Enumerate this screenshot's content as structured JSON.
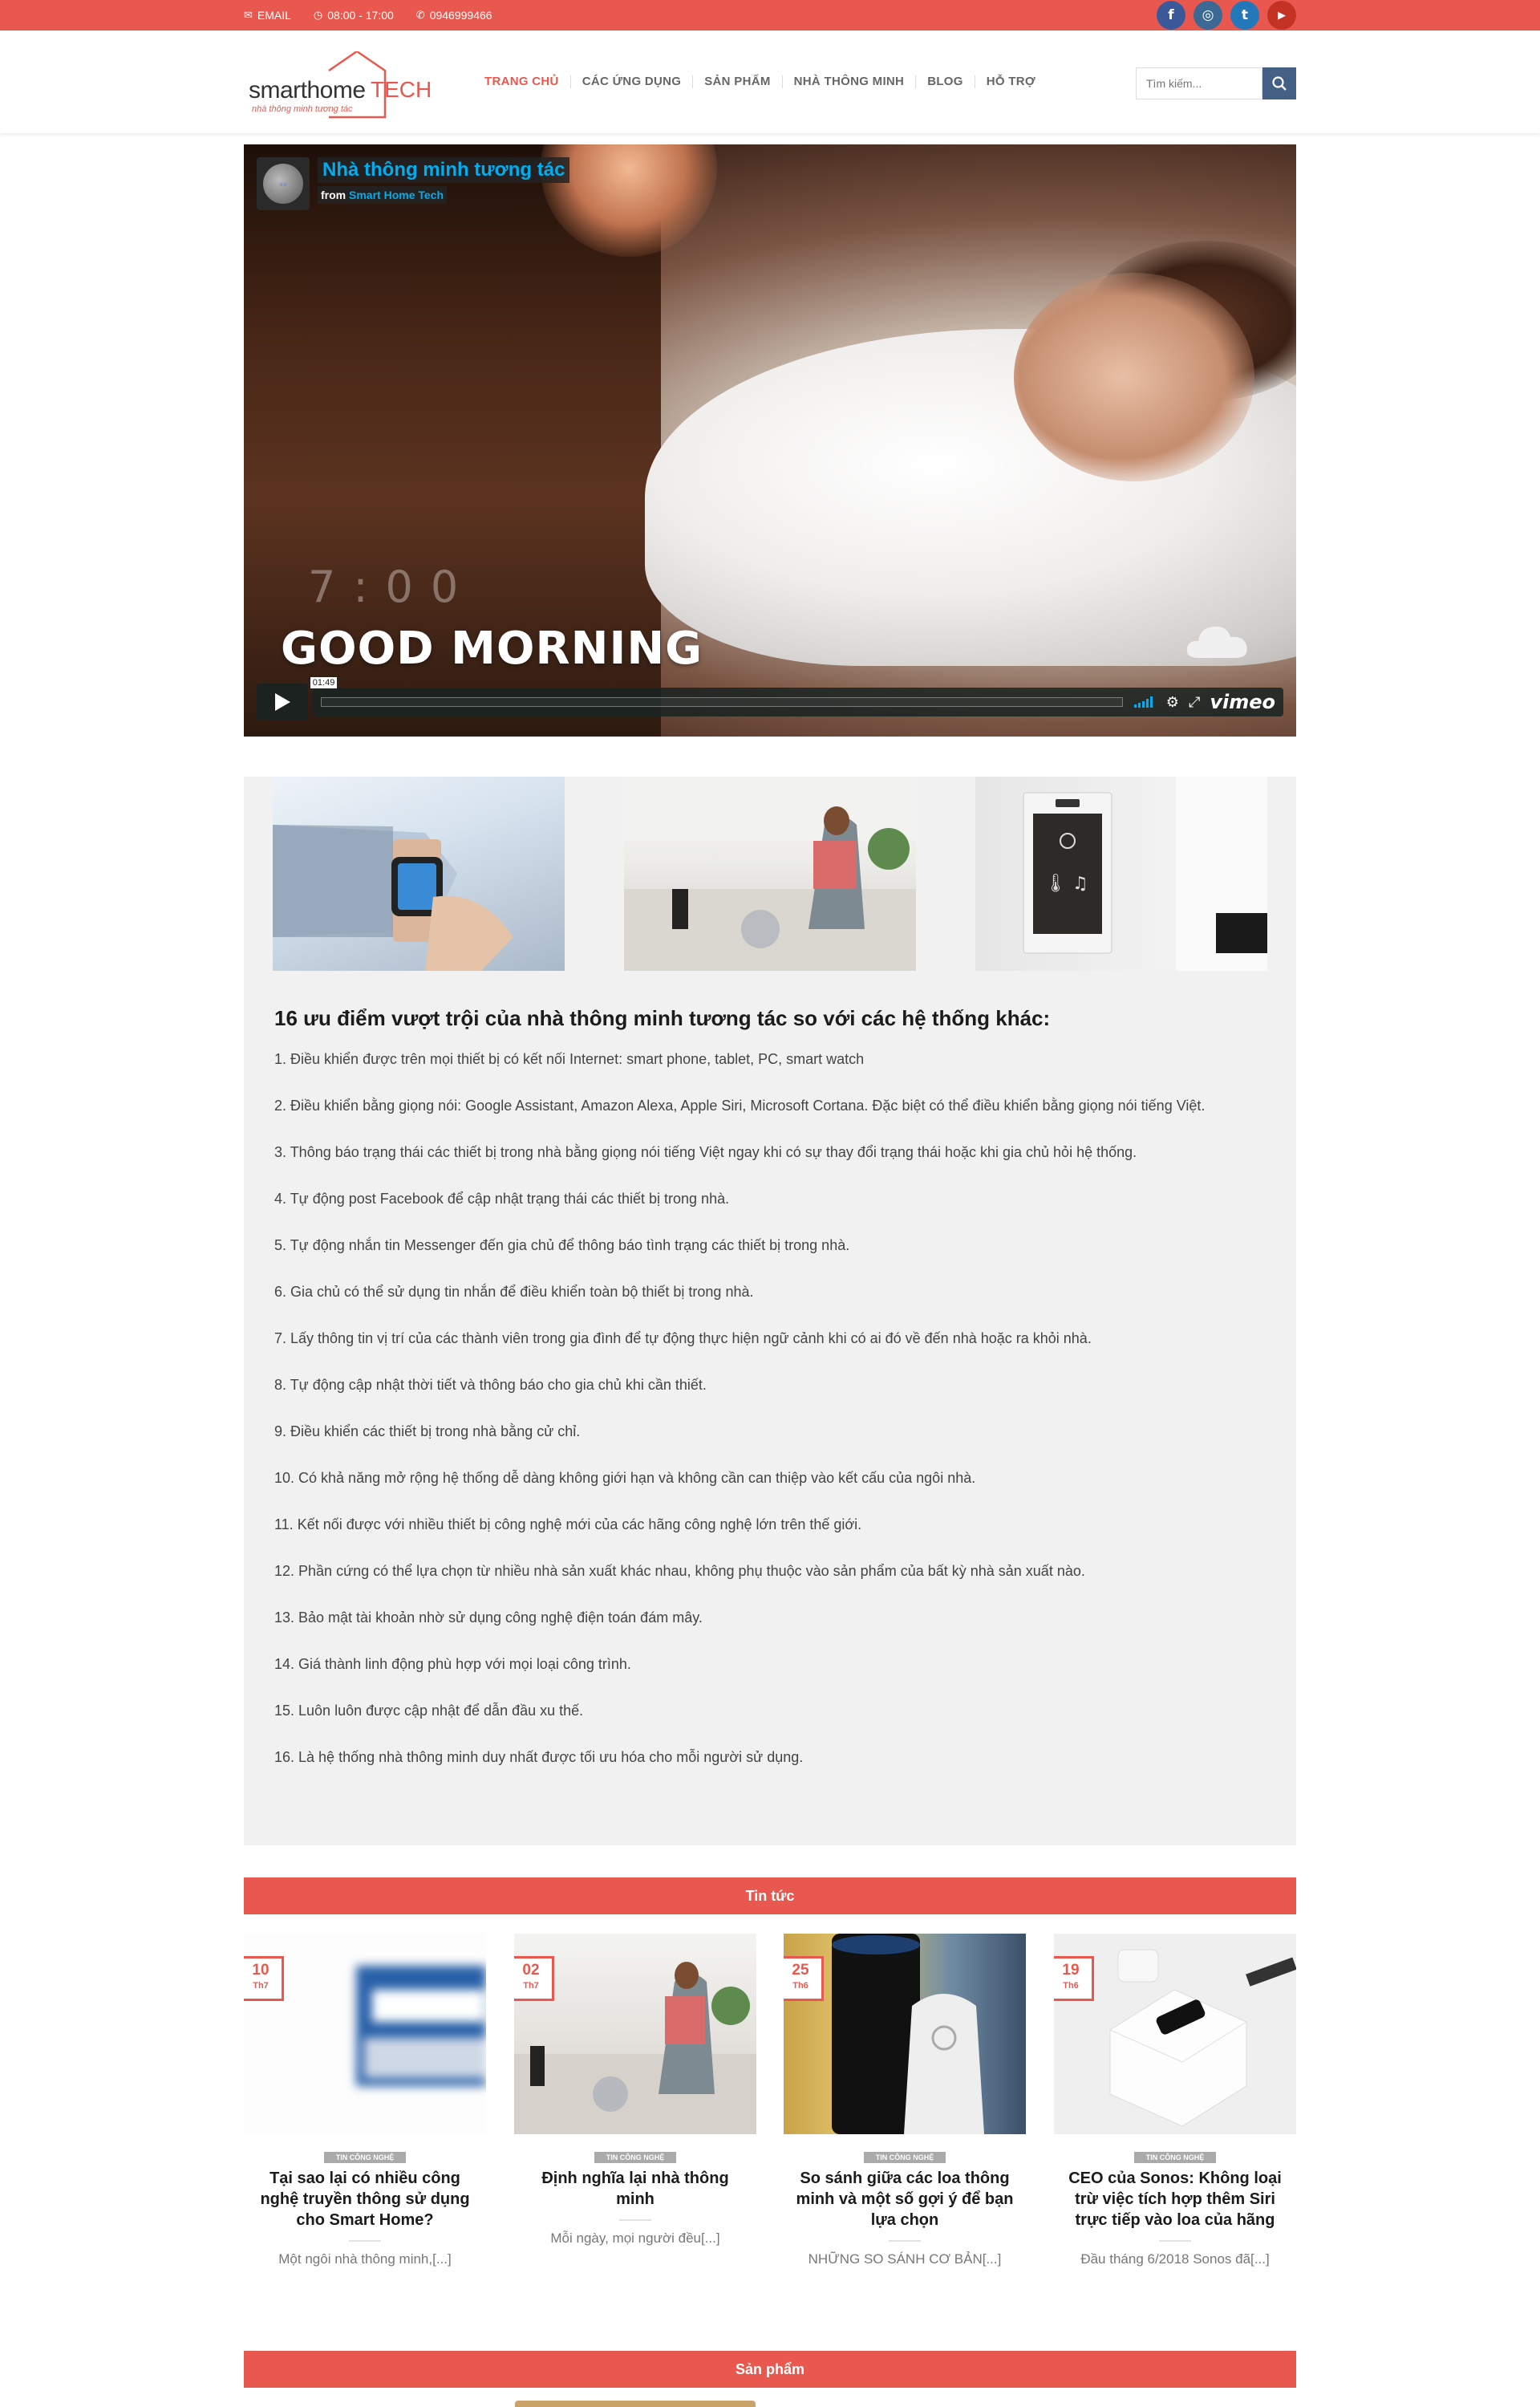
{
  "topbar": {
    "email": "EMAIL",
    "hours": "08:00 - 17:00",
    "phone": "0946999466",
    "social": [
      {
        "name": "facebook",
        "glyph": "f",
        "color": "#3b5998"
      },
      {
        "name": "instagram",
        "glyph": "◎",
        "color": "#3b6994"
      },
      {
        "name": "twitter",
        "glyph": "t",
        "color": "#2478ba"
      },
      {
        "name": "youtube",
        "glyph": "▶",
        "color": "#c33223"
      }
    ]
  },
  "header": {
    "logo_text": "smarthome",
    "logo_accent": "TECH",
    "logo_tagline": "nhà thông minh tương tác",
    "nav": [
      "TRANG CHỦ",
      "CÁC ỨNG DỤNG",
      "SẢN PHẨM",
      "NHÀ THÔNG MINH",
      "BLOG",
      "HỖ TRỢ"
    ],
    "search_placeholder": "Tìm kiếm..."
  },
  "video": {
    "title": "Nhà thông minh tương tác",
    "from_label": "from",
    "channel": "Smart Home Tech",
    "overlay_time": "7:00",
    "overlay_text": "GOOD MORNING",
    "duration": "01:49",
    "brand": "vimeo"
  },
  "features": {
    "title": "16 ưu điểm vượt trội của nhà thông minh tương tác so với các hệ thống khác:",
    "items": [
      "1. Điều khiển được trên mọi thiết bị có kết nối Internet: smart phone, tablet, PC, smart watch",
      "2. Điều khiển bằng giọng nói: Google Assistant, Amazon Alexa, Apple Siri, Microsoft Cortana. Đặc biệt có thể điều khiển bằng giọng nói tiếng Việt.",
      "3. Thông báo trạng thái các thiết bị trong nhà bằng giọng nói tiếng Việt ngay khi có sự thay đổi trạng thái hoặc khi gia chủ hỏi hệ thống.",
      "4. Tự động post Facebook để cập nhật trạng thái các thiết bị trong nhà.",
      "5. Tự động nhắn tin Messenger đến gia chủ để thông báo tình trạng các thiết bị trong nhà.",
      "6. Gia chủ có thể sử dụng tin nhắn để điều khiển  toàn bộ thiết bị trong nhà.",
      "7. Lấy thông tin vị trí của các thành viên trong gia đình để tự động thực hiện ngữ cảnh khi có ai đó về đến nhà hoặc ra khỏi nhà.",
      "8. Tự động cập nhật thời tiết và thông báo cho gia chủ khi cần thiết.",
      "9. Điều khiển các thiết bị trong nhà bằng cử chỉ.",
      "10. Có khả năng mở rộng hệ thống dễ dàng không giới hạn và không cần can thiệp vào kết cấu của ngôi nhà.",
      "11. Kết nối được với nhiều thiết bị công nghệ mới của các hãng công nghệ lớn trên thế giới.",
      "12. Phần cứng có thể lựa chọn từ nhiều nhà sản xuất khác nhau, không phụ thuộc vào sản phẩm của bất kỳ nhà sản xuất nào.",
      "13. Bảo mật tài khoản nhờ sử dụng công nghệ điện toán đám mây.",
      "14. Giá thành linh động phù hợp với mọi loại công trình.",
      "15. Luôn luôn được cập nhật để dẫn đầu xu thế.",
      "16. Là hệ thống nhà thông minh duy nhất được tối ưu hóa cho mỗi người sử dụng."
    ]
  },
  "news": {
    "heading": "Tin tức",
    "posts": [
      {
        "day": "10",
        "month": "Th7",
        "category": "TIN CÔNG NGHỆ",
        "title": "Tại sao lại có nhiều công nghệ truyền thông sử dụng cho Smart Home?",
        "excerpt": "Một ngôi nhà thông minh,[...]"
      },
      {
        "day": "02",
        "month": "Th7",
        "category": "TIN CÔNG NGHỆ",
        "title": "Định nghĩa lại nhà thông minh",
        "excerpt": "Mỗi ngày, mọi người đều[...]"
      },
      {
        "day": "25",
        "month": "Th6",
        "category": "TIN CÔNG NGHỆ",
        "title": "So sánh giữa các loa thông minh và một số gợi ý để bạn lựa chọn",
        "excerpt": "NHỮNG SO SÁNH CƠ BẢN[...]"
      },
      {
        "day": "19",
        "month": "Th6",
        "category": "TIN CÔNG NGHỆ",
        "title": "CEO của Sonos: Không loại trừ việc tích hợp thêm Siri trực tiếp vào loa của hãng",
        "excerpt": "Đầu tháng 6/2018 Sonos đã[...]"
      }
    ]
  },
  "products": {
    "heading": "Sản phẩm"
  },
  "colors": {
    "brand_red": "#e8584f",
    "search_blue": "#446084",
    "vimeo_blue": "#00adef"
  }
}
